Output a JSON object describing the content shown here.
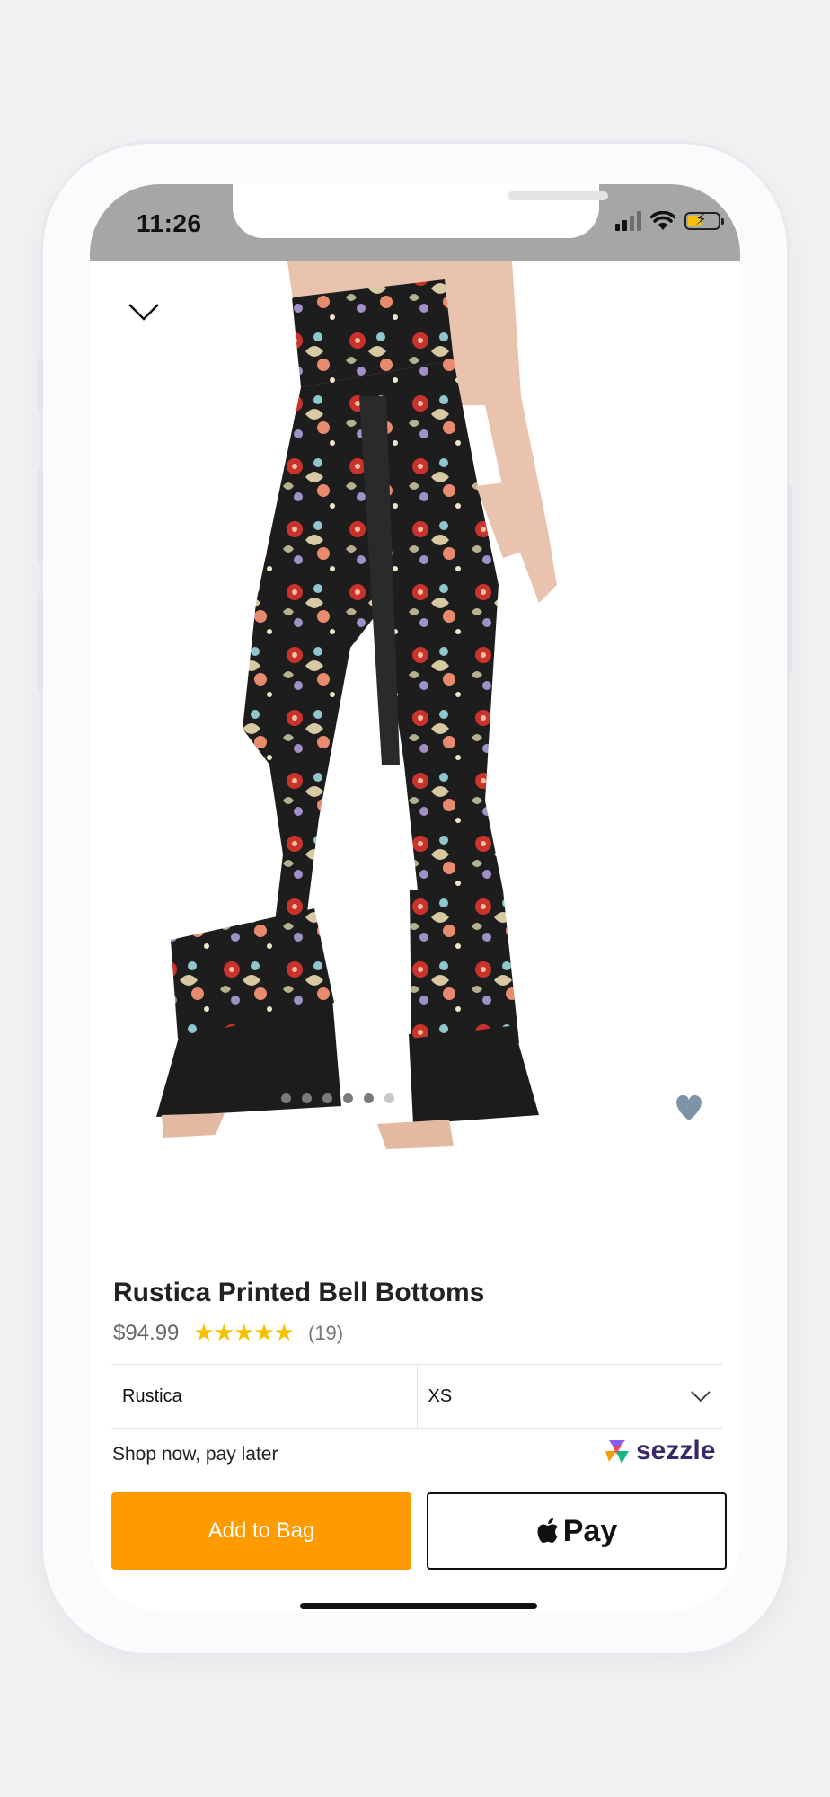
{
  "status_bar": {
    "time": "11:26"
  },
  "product": {
    "title": "Rustica Printed Bell Bottoms",
    "price": "$94.99",
    "rating_stars": "★★★★★",
    "rating": 5,
    "review_count": "(19)",
    "image_count": 6,
    "active_image": 6
  },
  "options": {
    "color_value": "Rustica",
    "size_value": "XS"
  },
  "payment": {
    "pay_later_text": "Shop now, pay later",
    "sezzle_label": "sezzle"
  },
  "actions": {
    "add_to_bag_label": "Add to Bag",
    "apple_pay_label": "Pay"
  },
  "colors": {
    "accent": "#ff9a00",
    "star": "#f5c000",
    "sezzle": "#392867",
    "heart": "#7e92a8"
  },
  "icons": [
    "chevron-down-icon",
    "heart-icon",
    "apple-icon",
    "sezzle-logo-icon",
    "signal-icon",
    "wifi-icon",
    "battery-icon"
  ]
}
